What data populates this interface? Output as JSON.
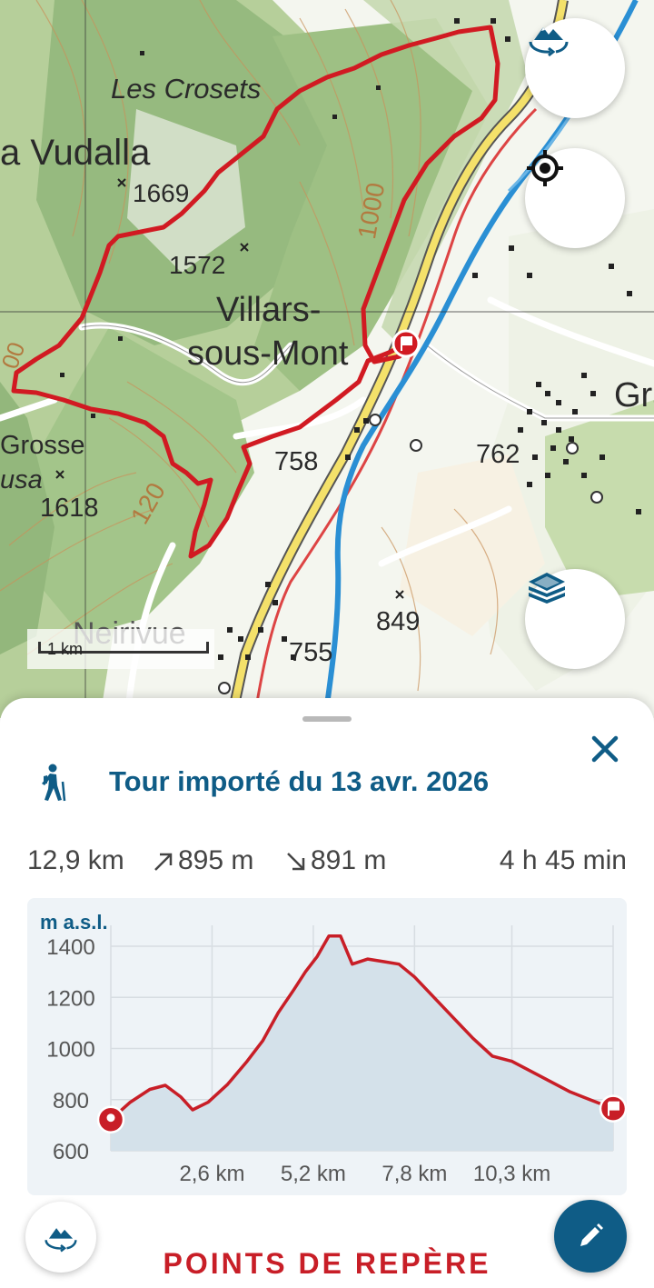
{
  "map": {
    "labels": {
      "les_crosets": "Les Crosets",
      "vudalla": "a Vudalla",
      "elev_1669": "1669",
      "elev_1572": "1572",
      "villars": "Villars-",
      "sous_mont": "sous-Mont",
      "grosse": "Grosse",
      "usa": "usa",
      "elev_1618": "1618",
      "contour_1000": "1000",
      "contour_1200": "120",
      "elev_758": "758",
      "elev_762": "762",
      "elev_849": "849",
      "elev_755": "755",
      "neirivue": "Neirivue",
      "gra": "Gra",
      "contour_00": "00"
    },
    "scale_label": "1 km",
    "route_color": "#d11a22",
    "buttons": {
      "view_3d_icon": "mountain-rotate-icon",
      "locate_icon": "crosshair-icon",
      "layers_icon": "layers-icon"
    }
  },
  "sheet": {
    "activity_icon": "hiker-icon",
    "title": "Tour importé du 13 avr. 2026",
    "close_icon": "close-icon",
    "stats": {
      "distance": "12,9 km",
      "ascent": "895 m",
      "descent": "891 m",
      "duration": "4 h 45 min"
    },
    "profile": {
      "y_label": "m a.s.l.",
      "y_ticks": [
        "1400",
        "1200",
        "1000",
        "800",
        "600"
      ],
      "x_ticks": [
        "2,6 km",
        "5,2 km",
        "7,8 km",
        "10,3 km"
      ]
    },
    "section_title": "POINTS DE REPÈRE",
    "edit_icon": "pencil-icon",
    "rotate_icon": "mountain-rotate-icon"
  },
  "chart_data": {
    "type": "area",
    "ylabel": "m a.s.l.",
    "xlabel": "",
    "ylim": [
      600,
      1480
    ],
    "xlim": [
      0,
      12.9
    ],
    "x_ticks": [
      2.6,
      5.2,
      7.8,
      10.3
    ],
    "y_ticks": [
      600,
      800,
      1000,
      1200,
      1400
    ],
    "grid": true,
    "fill_color": "#d4e1ea",
    "line_color": "#c81e27",
    "series": [
      {
        "x": [
          0,
          0.5,
          1.0,
          1.4,
          1.8,
          2.1,
          2.5,
          3.0,
          3.5,
          3.9,
          4.3,
          4.7,
          5.0,
          5.3,
          5.6,
          5.9,
          6.2,
          6.6,
          7.0,
          7.4,
          7.8,
          8.3,
          8.8,
          9.3,
          9.8,
          10.3,
          10.8,
          11.3,
          11.8,
          12.3,
          12.9
        ],
        "y": [
          722,
          790,
          840,
          856,
          810,
          760,
          790,
          860,
          950,
          1030,
          1140,
          1230,
          1300,
          1360,
          1440,
          1440,
          1330,
          1350,
          1340,
          1330,
          1280,
          1200,
          1120,
          1040,
          970,
          950,
          910,
          870,
          830,
          800,
          765
        ]
      }
    ],
    "markers": [
      {
        "x": 0,
        "y": 722,
        "kind": "start"
      },
      {
        "x": 12.9,
        "y": 765,
        "kind": "finish"
      }
    ]
  }
}
